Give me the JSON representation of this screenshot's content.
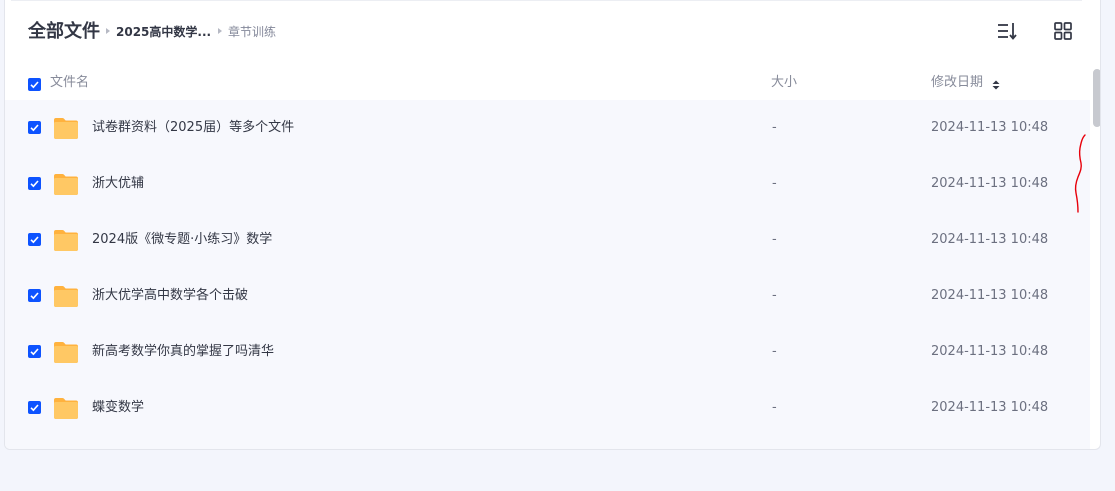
{
  "breadcrumb": {
    "root": "全部文件",
    "items": [
      "2025高中数学...",
      "章节训练"
    ]
  },
  "toolbar": {
    "sort_icon": "sort-list-icon",
    "view_icon": "grid-view-icon"
  },
  "columns": {
    "name": "文件名",
    "size": "大小",
    "modified": "修改日期"
  },
  "files": [
    {
      "name": "试卷群资料（2025届）等多个文件",
      "size": "-",
      "modified": "2024-11-13 10:48",
      "checked": true
    },
    {
      "name": "浙大优辅",
      "size": "-",
      "modified": "2024-11-13 10:48",
      "checked": true
    },
    {
      "name": "2024版《微专题·小练习》数学",
      "size": "-",
      "modified": "2024-11-13 10:48",
      "checked": true
    },
    {
      "name": "浙大优学高中数学各个击破",
      "size": "-",
      "modified": "2024-11-13 10:48",
      "checked": true
    },
    {
      "name": "新高考数学你真的掌握了吗清华",
      "size": "-",
      "modified": "2024-11-13 10:48",
      "checked": true
    },
    {
      "name": "蝶变数学",
      "size": "-",
      "modified": "2024-11-13 10:48",
      "checked": true
    }
  ],
  "colors": {
    "accent": "#0d53ff",
    "folder": "#ffc15a",
    "annotation": "#e8000b"
  }
}
